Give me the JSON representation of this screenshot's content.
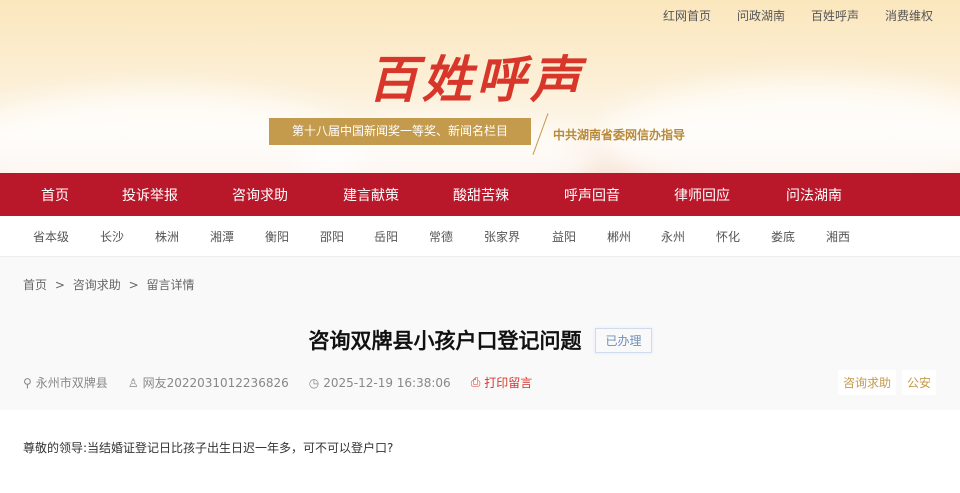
{
  "top_links": [
    "红网首页",
    "问政湖南",
    "百姓呼声",
    "消费维权"
  ],
  "logo_text": "百姓呼声",
  "ribbon": "第十八届中国新闻奖一等奖、新闻名栏目",
  "guidance": "中共湖南省委网信办指导",
  "nav": [
    "首页",
    "投诉举报",
    "咨询求助",
    "建言献策",
    "酸甜苦辣",
    "呼声回音",
    "律师回应",
    "问法湖南"
  ],
  "cities": [
    "省本级",
    "长沙",
    "株洲",
    "湘潭",
    "衡阳",
    "邵阳",
    "岳阳",
    "常德",
    "张家界",
    "益阳",
    "郴州",
    "永州",
    "怀化",
    "娄底",
    "湘西"
  ],
  "breadcrumb": [
    "首页",
    "咨询求助",
    "留言详情"
  ],
  "breadcrumb_sep": ">",
  "title": "咨询双牌县小孩户口登记问题",
  "status": "已办理",
  "meta": {
    "location": "永州市双牌县",
    "user": "网友2022031012236826",
    "time": "2025-12-19 16:38:06",
    "print": "打印留言"
  },
  "tags": [
    "咨询求助",
    "公安"
  ],
  "content": "尊敬的领导:当结婚证登记日比孩子出生日迟一年多，可不可以登户口?"
}
